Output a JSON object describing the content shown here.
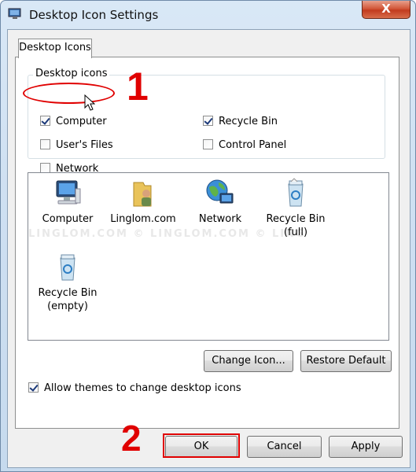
{
  "window": {
    "title": "Desktop Icon Settings",
    "close_label": "X"
  },
  "tab": {
    "label": "Desktop Icons"
  },
  "group": {
    "label": "Desktop icons",
    "checkboxes": [
      {
        "label": "Computer",
        "checked": true
      },
      {
        "label": "Recycle Bin",
        "checked": true
      },
      {
        "label": "User's Files",
        "checked": false
      },
      {
        "label": "Control Panel",
        "checked": false
      },
      {
        "label": "Network",
        "checked": false
      }
    ]
  },
  "icons": [
    {
      "label": "Computer",
      "icon": "computer-icon"
    },
    {
      "label": "Linglom.com",
      "icon": "user-folder-icon"
    },
    {
      "label": "Network",
      "icon": "network-globe-icon"
    },
    {
      "label": "Recycle Bin\n(full)",
      "line1": "Recycle Bin",
      "line2": "(full)",
      "icon": "recycle-bin-full-icon"
    },
    {
      "label": "Recycle Bin (empty)",
      "line1": "Recycle Bin",
      "line2": "(empty)",
      "icon": "recycle-bin-empty-icon"
    }
  ],
  "watermark": "LINGLOM.COM    © LINGLOM.COM    © LING",
  "buttons": {
    "change_icon": "Change Icon...",
    "restore_default": "Restore Default",
    "ok": "OK",
    "cancel": "Cancel",
    "apply": "Apply"
  },
  "themes_checkbox": {
    "label": "Allow themes to change desktop icons",
    "checked": true
  },
  "annotations": {
    "step1": "1",
    "step2": "2",
    "color": "#e00000"
  }
}
